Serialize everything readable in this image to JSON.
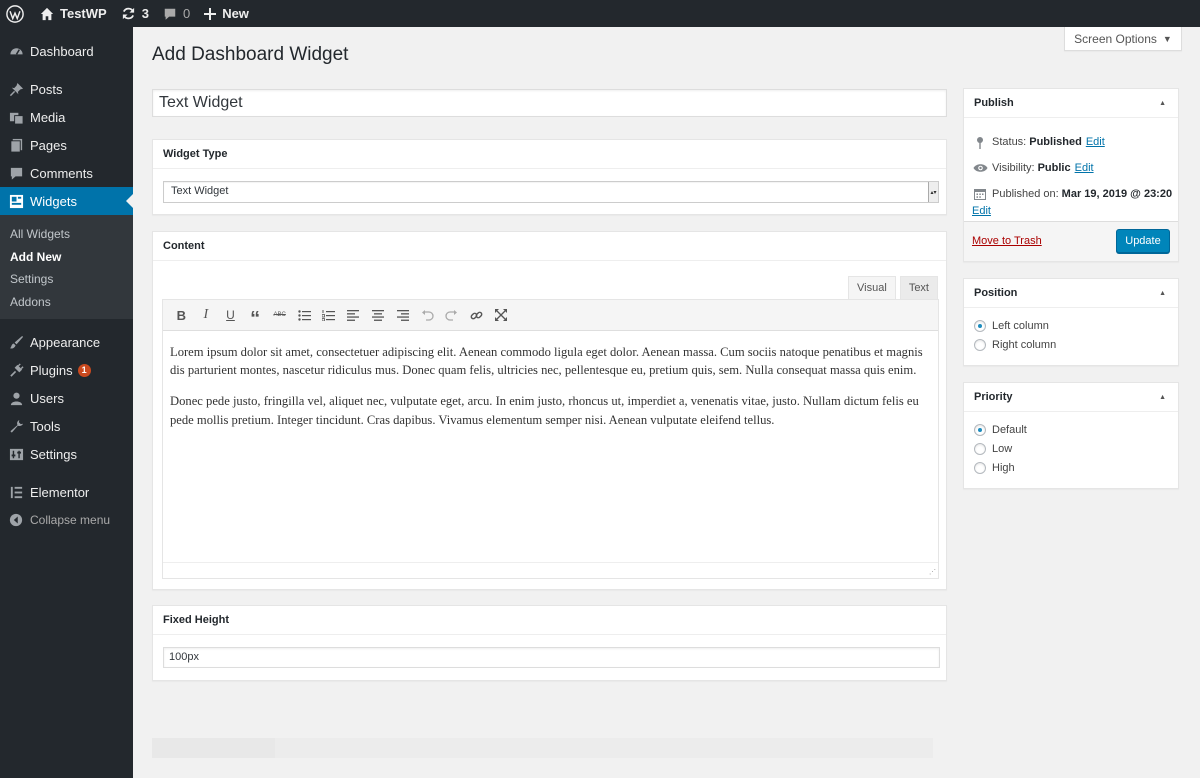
{
  "admin_bar": {
    "site_name": "TestWP",
    "updates_count": "3",
    "comments_count": "0",
    "new_label": "New"
  },
  "sidebar": {
    "items": [
      {
        "label": "Dashboard",
        "icon": "dashboard-icon"
      },
      {
        "label": "Posts",
        "icon": "pin-icon"
      },
      {
        "label": "Media",
        "icon": "media-icon"
      },
      {
        "label": "Pages",
        "icon": "pages-icon"
      },
      {
        "label": "Comments",
        "icon": "comment-icon"
      },
      {
        "label": "Widgets",
        "icon": "widgets-icon",
        "active": true
      }
    ],
    "submenu": [
      "All Widgets",
      "Add New",
      "Settings",
      "Addons"
    ],
    "items2": [
      {
        "label": "Appearance",
        "icon": "brush-icon"
      },
      {
        "label": "Plugins",
        "icon": "plugin-icon",
        "badge": "1"
      },
      {
        "label": "Users",
        "icon": "user-icon"
      },
      {
        "label": "Tools",
        "icon": "wrench-icon"
      },
      {
        "label": "Settings",
        "icon": "settings-icon"
      },
      {
        "label": "Elementor",
        "icon": "elementor-icon"
      }
    ],
    "collapse_label": "Collapse menu"
  },
  "screen_options": "Screen Options",
  "page_title": "Add Dashboard Widget",
  "title_value": "Text Widget",
  "widget_type": {
    "heading": "Widget Type",
    "selected": "Text Widget"
  },
  "content": {
    "heading": "Content",
    "tabs": [
      "Visual",
      "Text"
    ],
    "paragraphs": [
      "Lorem ipsum dolor sit amet, consectetuer adipiscing elit. Aenean commodo ligula eget dolor. Aenean massa. Cum sociis natoque penatibus et magnis dis parturient montes, nascetur ridiculus mus. Donec quam felis, ultricies nec, pellentesque eu, pretium quis, sem. Nulla consequat massa quis enim.",
      "Donec pede justo, fringilla vel, aliquet nec, vulputate eget, arcu. In enim justo, rhoncus ut, imperdiet a, venenatis vitae, justo. Nullam dictum felis eu pede mollis pretium. Integer tincidunt. Cras dapibus. Vivamus elementum semper nisi. Aenean vulputate eleifend tellus."
    ]
  },
  "fixed_height": {
    "heading": "Fixed Height",
    "value": "100px"
  },
  "publish": {
    "heading": "Publish",
    "status_label": "Status:",
    "status_value": "Published",
    "visibility_label": "Visibility:",
    "visibility_value": "Public",
    "published_label": "Published on:",
    "published_value": "Mar 19, 2019 @ 23:20",
    "edit_label": "Edit",
    "trash_label": "Move to Trash",
    "update_label": "Update"
  },
  "position": {
    "heading": "Position",
    "options": [
      "Left column",
      "Right column"
    ],
    "selected": "Left column"
  },
  "priority": {
    "heading": "Priority",
    "options": [
      "Default",
      "Low",
      "High"
    ],
    "selected": "Default"
  },
  "colors": {
    "accent": "#0073aa",
    "button": "#0085ba",
    "admin_bg": "#23282d",
    "badge": "#ca4a1f",
    "trash": "#a00"
  }
}
